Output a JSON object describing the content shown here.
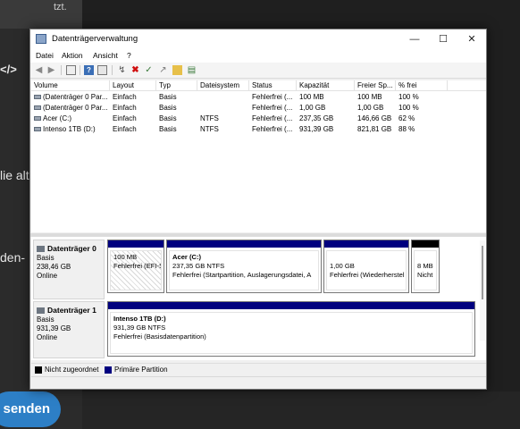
{
  "background": {
    "text_top": "tzt.",
    "text_code": "</>",
    "text_alt": "lie alt",
    "text_den": "den-",
    "send_button": "senden"
  },
  "window": {
    "title": "Datenträgerverwaltung",
    "controls": {
      "minimize": "—",
      "maximize": "☐",
      "close": "✕"
    },
    "menu": [
      "Datei",
      "Aktion",
      "Ansicht",
      "?"
    ]
  },
  "toolbar": {
    "icons": [
      "back-arrow-icon",
      "forward-arrow-icon",
      "list-view-icon",
      "help-icon",
      "properties-icon",
      "connect-icon",
      "delete-icon",
      "checklist-icon",
      "import-icon",
      "folder-icon",
      "properties-sheet-icon"
    ]
  },
  "volumes": {
    "columns": [
      "Volume",
      "Layout",
      "Typ",
      "Dateisystem",
      "Status",
      "Kapazität",
      "Freier Sp...",
      "% frei"
    ],
    "rows": [
      [
        "(Datenträger 0 Par...",
        "Einfach",
        "Basis",
        "",
        "Fehlerfrei (...",
        "100 MB",
        "100 MB",
        "100 %"
      ],
      [
        "(Datenträger 0 Par...",
        "Einfach",
        "Basis",
        "",
        "Fehlerfrei (...",
        "1,00 GB",
        "1,00 GB",
        "100 %"
      ],
      [
        "Acer (C:)",
        "Einfach",
        "Basis",
        "NTFS",
        "Fehlerfrei (...",
        "237,35 GB",
        "146,66 GB",
        "62 %"
      ],
      [
        "Intenso 1TB (D:)",
        "Einfach",
        "Basis",
        "NTFS",
        "Fehlerfrei (...",
        "931,39 GB",
        "821,81 GB",
        "88 %"
      ]
    ]
  },
  "disks": [
    {
      "name": "Datenträger 0",
      "type": "Basis",
      "size": "238,46 GB",
      "state": "Online",
      "partitions": [
        {
          "title": "",
          "size": "100 MB",
          "status": "Fehlerfrei (EFI-S"
        },
        {
          "title": "Acer  (C:)",
          "size": "237,35 GB NTFS",
          "status": "Fehlerfrei (Startpartition, Auslagerungsdatei, A"
        },
        {
          "title": "",
          "size": "1,00 GB",
          "status": "Fehlerfrei (Wiederherstel"
        },
        {
          "title": "",
          "size": "8 MB",
          "status": "Nicht"
        }
      ]
    },
    {
      "name": "Datenträger 1",
      "type": "Basis",
      "size": "931,39 GB",
      "state": "Online",
      "partitions": [
        {
          "title": "Intenso 1TB  (D:)",
          "size": "931,39 GB NTFS",
          "status": "Fehlerfrei (Basisdatenpartition)"
        }
      ]
    }
  ],
  "legend": [
    {
      "label": "Nicht zugeordnet",
      "color": "#000000"
    },
    {
      "label": "Primäre Partition",
      "color": "#00007f"
    }
  ],
  "colors": {
    "primary_partition": "#00007f",
    "unallocated": "#000000"
  }
}
